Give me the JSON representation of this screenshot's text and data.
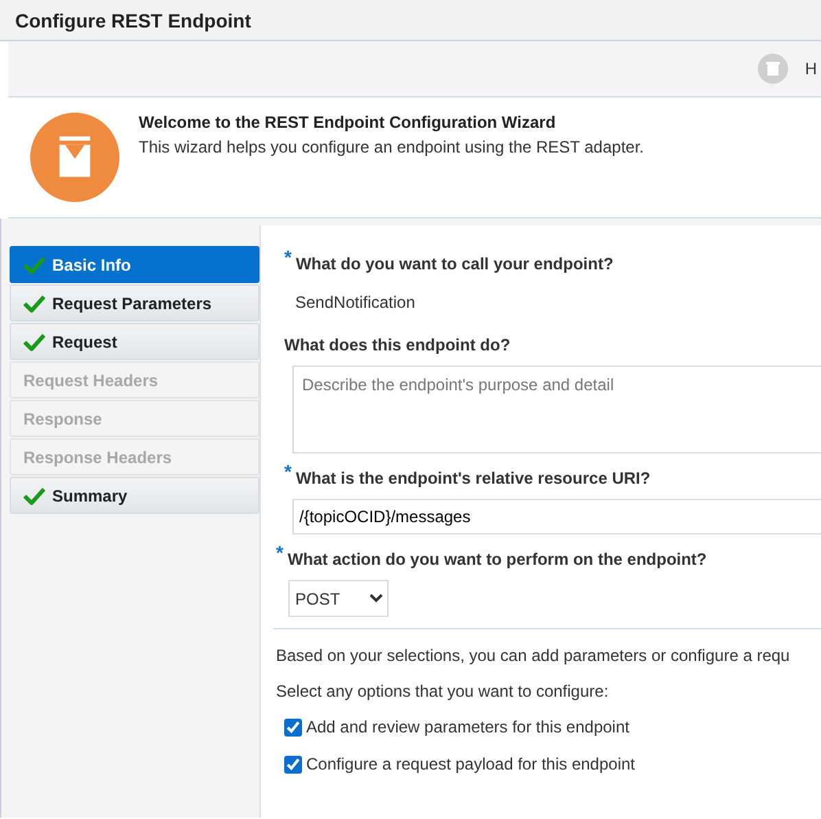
{
  "window": {
    "title": "Configure REST Endpoint"
  },
  "toolbar": {
    "help_label": "H"
  },
  "welcome": {
    "heading": "Welcome to the REST Endpoint Configuration Wizard",
    "text": "This wizard helps you configure an endpoint using the REST adapter."
  },
  "steps": [
    {
      "label": "Basic Info",
      "selected": true,
      "completed": true,
      "disabled": false
    },
    {
      "label": "Request Parameters",
      "selected": false,
      "completed": true,
      "disabled": false
    },
    {
      "label": "Request",
      "selected": false,
      "completed": true,
      "disabled": false
    },
    {
      "label": "Request Headers",
      "selected": false,
      "completed": false,
      "disabled": true
    },
    {
      "label": "Response",
      "selected": false,
      "completed": false,
      "disabled": true
    },
    {
      "label": "Response Headers",
      "selected": false,
      "completed": false,
      "disabled": true
    },
    {
      "label": "Summary",
      "selected": false,
      "completed": true,
      "disabled": false
    }
  ],
  "form": {
    "fields": [
      {
        "kind": "readonly",
        "required_mark": "*",
        "label": "What do you want to call your endpoint?",
        "value": "SendNotification"
      },
      {
        "kind": "textarea",
        "label": "What does this endpoint do?",
        "placeholder": "Describe the endpoint's purpose and detail"
      },
      {
        "kind": "input",
        "required_mark": "*",
        "label": "What is the endpoint's relative resource URI?",
        "value": "/{topicOCID}/messages"
      },
      {
        "kind": "select",
        "required_mark": "*",
        "label": "What action do you want to perform on the endpoint?",
        "value": "POST"
      }
    ],
    "info": "Based on your selections, you can add parameters or configure a requ",
    "prompt": "Select any options that you want to configure:",
    "options": [
      {
        "label": "Add and review parameters for this endpoint",
        "checked": true
      },
      {
        "label": "Configure a request payload for this endpoint",
        "checked": true
      }
    ]
  }
}
